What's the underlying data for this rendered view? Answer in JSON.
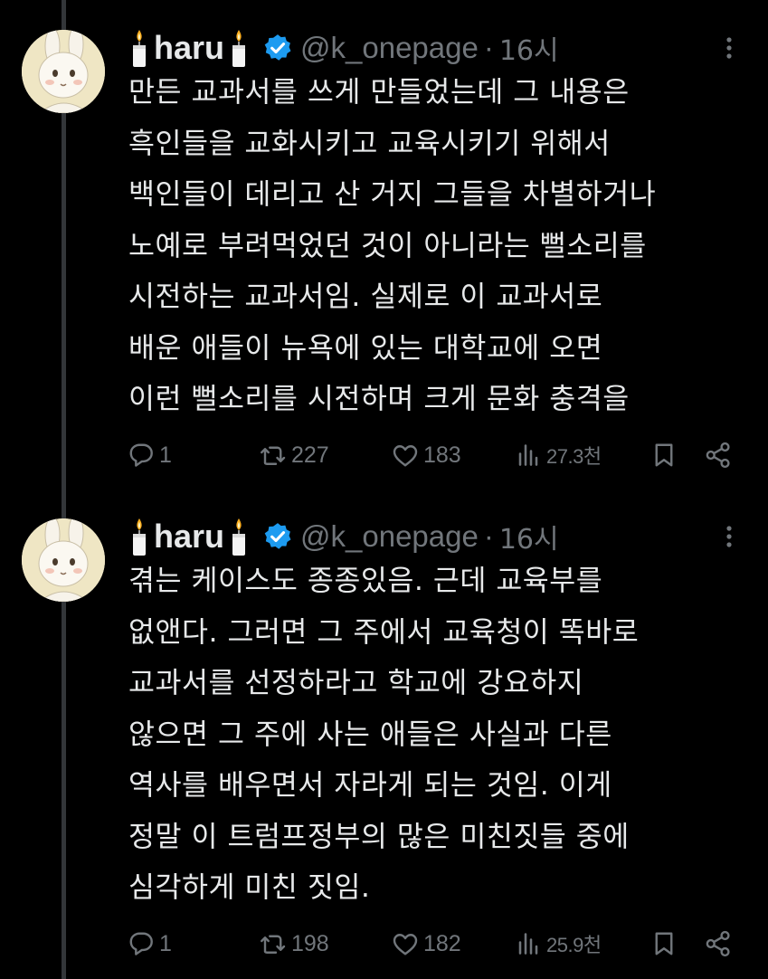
{
  "tweets": [
    {
      "name": "haru",
      "handle": "@k_onepage",
      "separator": "·",
      "time": "16시",
      "lines": [
        "만든 교과서를 쓰게 만들었는데 그 내용은",
        "흑인들을 교화시키고 교육시키기 위해서",
        "백인들이 데리고 산 거지 그들을 차별하거나",
        "노예로 부려먹었던 것이 아니라는 뻘소리를",
        "시전하는 교과서임. 실제로 이 교과서로",
        "배운 애들이 뉴욕에 있는 대학교에 오면",
        "이런 뻘소리를 시전하며 크게 문화 충격을"
      ],
      "stats": {
        "replies": "1",
        "retweets": "227",
        "likes": "183",
        "views": "27.3천"
      }
    },
    {
      "name": "haru",
      "handle": "@k_onepage",
      "separator": "·",
      "time": "16시",
      "lines": [
        "겪는 케이스도 종종있음. 근데 교육부를",
        "없앤다. 그러면 그 주에서 교육청이 똑바로",
        "교과서를 선정하라고 학교에 강요하지",
        "않으면 그 주에 사는 애들은 사실과 다른",
        "역사를 배우면서 자라게 되는 것임. 이게",
        "정말 이 트럼프정부의 많은 미친짓들 중에",
        "심각하게 미친 짓임."
      ],
      "stats": {
        "replies": "1",
        "retweets": "198",
        "likes": "182",
        "views": "25.9천"
      }
    }
  ],
  "icons": {
    "name_decoration": "candle-icon",
    "badge": "verified-badge-icon",
    "more": "more-dots-icon",
    "reply": "reply-bubble-icon",
    "retweet": "retweet-icon",
    "like": "heart-icon",
    "views": "views-bar-chart-icon",
    "bookmark": "bookmark-icon",
    "share": "share-icon"
  },
  "colors": {
    "background": "#000000",
    "text": "#e7e9ea",
    "secondary": "#71767b",
    "verified": "#1d9bf0",
    "thread_line": "#333639"
  }
}
